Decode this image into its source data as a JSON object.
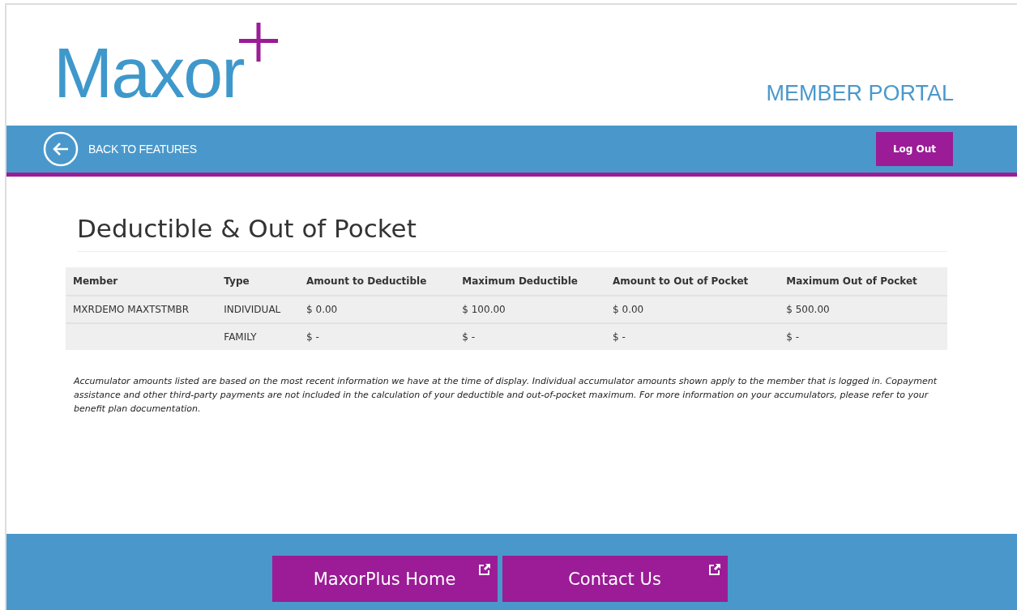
{
  "header": {
    "logo": "Maxor",
    "portal_title": "MEMBER PORTAL"
  },
  "nav": {
    "back_link": "BACK TO FEATURES",
    "logout": "Log Out"
  },
  "page_title": "Deductible & Out of Pocket",
  "table": {
    "columns": [
      "Member",
      "Type",
      "Amount to Deductible",
      "Maximum Deductible",
      "Amount to Out of Pocket",
      "Maximum Out of Pocket"
    ],
    "rows": [
      [
        "MXRDEMO MAXTSTMBR",
        "INDIVIDUAL",
        "$ 0.00",
        "$ 100.00",
        "$ 0.00",
        "$ 500.00"
      ],
      [
        "",
        "FAMILY",
        "$ -",
        "$ -",
        "$ -",
        "$ -"
      ]
    ]
  },
  "disclaimer": "Accumulator amounts listed are based on the most recent information we have at the time of display. Individual accumulator amounts shown apply to the member that is logged in. Copayment assistance and other third-party payments are not included in the calculation of your deductible and out-of-pocket maximum. For more information on your accumulators, please refer to your benefit plan documentation.",
  "footer_links": [
    "MaxorPlus Home",
    "Contact Us"
  ]
}
